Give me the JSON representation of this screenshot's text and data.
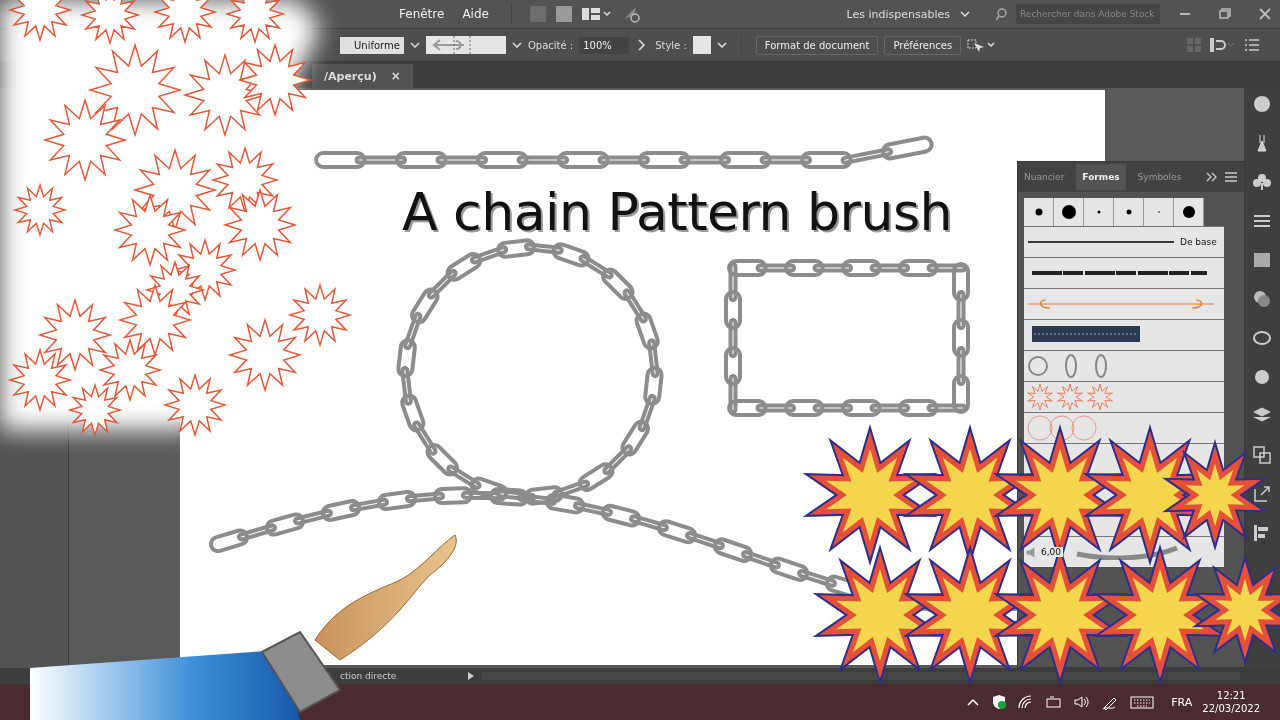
{
  "menu_bar": {
    "menus": [
      "Fenêtre",
      "Aide"
    ],
    "workspace": "Les indispensables",
    "search": {
      "placeholder": "Rechercher dans Adobe Stock"
    }
  },
  "control_bar": {
    "stroke_profile": "Uniforme",
    "opacity_label": "Opacité :",
    "opacity": "100%",
    "style_label": "Style :",
    "buttons": [
      "Format de document",
      "Préférences"
    ]
  },
  "document_tab": {
    "title": "/Aperçu)",
    "close": "×"
  },
  "artboard": {
    "headline": "A chain Pattern brush"
  },
  "brushes_panel": {
    "tabs": [
      {
        "label": "Nuancier",
        "selected": false
      },
      {
        "label": "Formes",
        "selected": true
      },
      {
        "label": "Symboles",
        "selected": false
      }
    ],
    "default_brush": "De base",
    "stroke_weight": "6,00"
  },
  "status_bar": {
    "tool": "ction directe"
  },
  "taskbar": {
    "language": "FRA",
    "time": "12:21",
    "date": "22/03/2022"
  }
}
